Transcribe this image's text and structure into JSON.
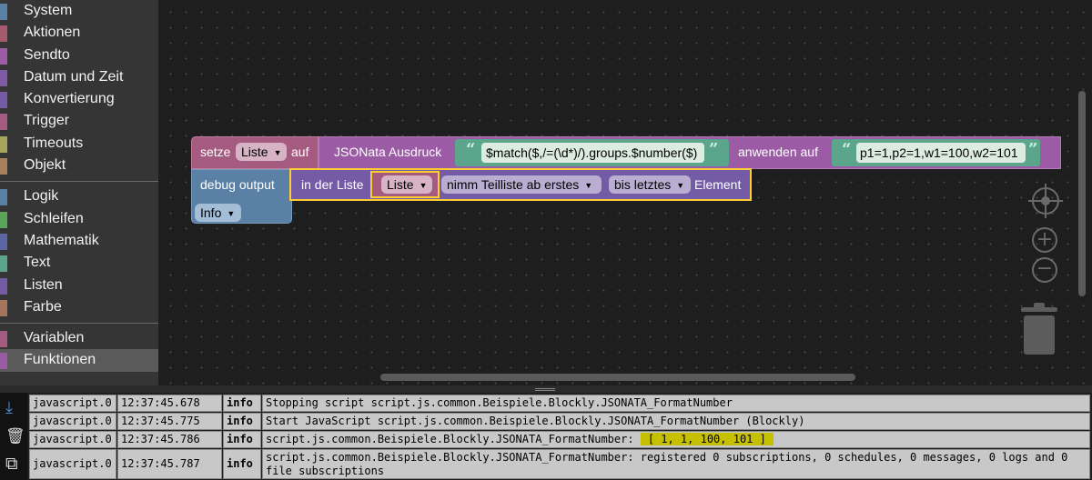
{
  "toolbox": {
    "groups": [
      [
        {
          "label": "System",
          "color": "#5b80a5"
        },
        {
          "label": "Aktionen",
          "color": "#a55b6d"
        },
        {
          "label": "Sendto",
          "color": "#9b5ba5"
        },
        {
          "label": "Datum und Zeit",
          "color": "#805ba5"
        },
        {
          "label": "Konvertierung",
          "color": "#745ba5"
        },
        {
          "label": "Trigger",
          "color": "#a55b80"
        },
        {
          "label": "Timeouts",
          "color": "#a5a55b"
        },
        {
          "label": "Objekt",
          "color": "#a5805b"
        }
      ],
      [
        {
          "label": "Logik",
          "color": "#5b80a5"
        },
        {
          "label": "Schleifen",
          "color": "#5ba55b"
        },
        {
          "label": "Mathematik",
          "color": "#5b67a5"
        },
        {
          "label": "Text",
          "color": "#5ba58c"
        },
        {
          "label": "Listen",
          "color": "#745ba5"
        },
        {
          "label": "Farbe",
          "color": "#a5745b"
        }
      ],
      [
        {
          "label": "Variablen",
          "color": "#a55b80"
        },
        {
          "label": "Funktionen",
          "color": "#995ba5"
        }
      ]
    ]
  },
  "blocks": {
    "set": {
      "label": "setze",
      "var": "Liste",
      "to": "auf"
    },
    "jsonata": {
      "label": "JSONata Ausdruck",
      "expr": "$match($,/=(\\d*)/).groups.$number($)",
      "apply": "anwenden auf",
      "input": "p1=1,p2=1,w1=100,w2=101"
    },
    "debug": {
      "label": "debug output",
      "level": "Info"
    },
    "sublist": {
      "in": "in der Liste",
      "var": "Liste",
      "from": "nimm Teilliste ab erstes",
      "to": "bis letztes",
      "element": "Element"
    },
    "quote_open": "“",
    "quote_close": "”"
  },
  "log": {
    "rows": [
      {
        "source": "javascript.0",
        "time": "12:37:45.678",
        "severity": "info",
        "message": "Stopping script script.js.common.Beispiele.Blockly.JSONATA_FormatNumber"
      },
      {
        "source": "javascript.0",
        "time": "12:37:45.775",
        "severity": "info",
        "message": "Start JavaScript script.js.common.Beispiele.Blockly.JSONATA_FormatNumber (Blockly)"
      },
      {
        "source": "javascript.0",
        "time": "12:37:45.786",
        "severity": "info",
        "message_prefix": "script.js.common.Beispiele.Blockly.JSONATA_FormatNumber: ",
        "message_highlight": "[ 1, 1, 100, 101 ]"
      },
      {
        "source": "javascript.0",
        "time": "12:37:45.787",
        "severity": "info",
        "message": "script.js.common.Beispiele.Blockly.JSONATA_FormatNumber: registered 0 subscriptions, 0 schedules, 0 messages, 0 logs and 0 file subscriptions"
      }
    ]
  },
  "icons": {
    "workspace": [
      "target-icon",
      "zoom-in-icon",
      "zoom-out-icon",
      "trash-icon"
    ],
    "log_tools": [
      "download-icon",
      "delete-icon",
      "copy-icon"
    ]
  },
  "colors": {
    "variables": "#a55b80",
    "jsonata": "#9b5ba5",
    "text": "#5ba58c",
    "debug": "#5b80a5",
    "lists": "#745ba5",
    "highlight": "#c6c000"
  }
}
